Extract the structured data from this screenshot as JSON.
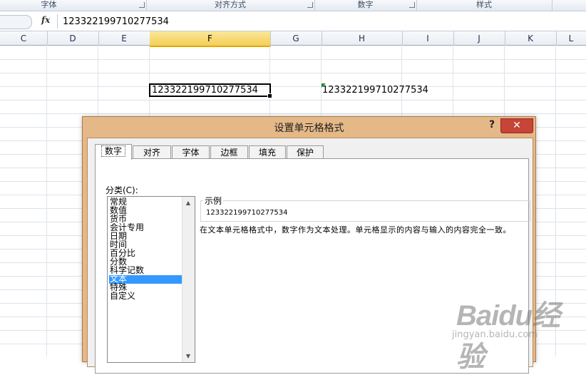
{
  "ribbon": {
    "groups": [
      "字体",
      "对齐方式",
      "数字",
      "样式"
    ]
  },
  "formula_bar": {
    "fx_label": "fx",
    "value": "123322199710277534"
  },
  "columns": [
    "C",
    "D",
    "E",
    "F",
    "G",
    "H",
    "I",
    "J",
    "K",
    "L"
  ],
  "selected_column": "F",
  "cells": {
    "F": "123322199710277534",
    "H": "123322199710277534"
  },
  "dialog": {
    "title": "设置单元格格式",
    "help": "?",
    "close": "✕",
    "tabs": [
      "数字",
      "对齐",
      "字体",
      "边框",
      "填充",
      "保护"
    ],
    "active_tab": "数字",
    "category_label": "分类(C):",
    "categories": [
      "常规",
      "数值",
      "货币",
      "会计专用",
      "日期",
      "时间",
      "百分比",
      "分数",
      "科学记数",
      "文本",
      "特殊",
      "自定义"
    ],
    "selected_category": "文本",
    "sample_legend": "示例",
    "sample_value": "123322199710277534",
    "description": "在文本单元格格式中，数字作为文本处理。单元格显示的内容与输入的内容完全一致。"
  },
  "watermark": {
    "brand": "Baidu经验",
    "url": "jingyan.baidu.com"
  },
  "colors": {
    "dialog_frame": "#e5b887",
    "close_button": "#c64438",
    "selection": "#3399ff",
    "selected_column_header": "#f4cf57"
  }
}
